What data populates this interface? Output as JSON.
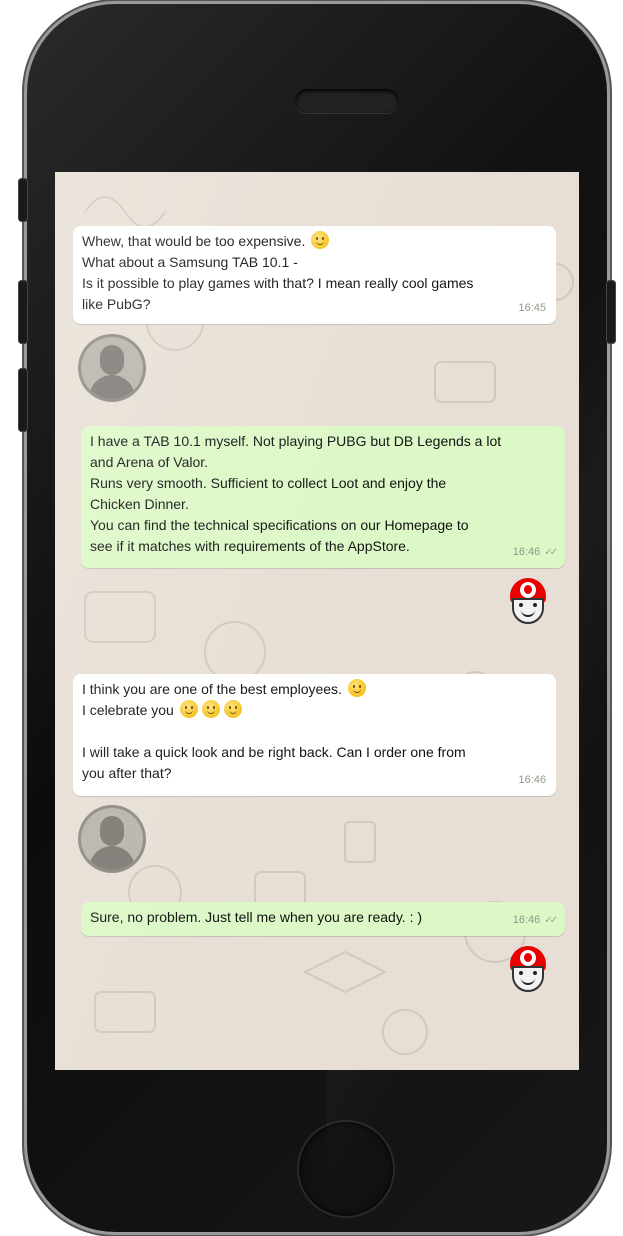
{
  "chat": {
    "messages": [
      {
        "direction": "incoming",
        "lines": [
          "Whew, that would be too expensive.",
          "What about a Samsung TAB 10.1 -",
          "Is it possible to play games with that? I mean really cool games",
          "like PubG?"
        ],
        "time": "16:45"
      },
      {
        "direction": "outgoing",
        "lines": [
          "I have a TAB 10.1 myself. Not playing PUBG but DB Legends a lot",
          "and Arena of Valor.",
          "Runs very smooth. Sufficient to collect Loot and enjoy the",
          "Chicken Dinner.",
          "You can find the technical specifications on our Homepage to",
          "see if it matches with requirements of the AppStore."
        ],
        "time": "16:46"
      },
      {
        "direction": "incoming",
        "lines": [
          "I think you are one of the best employees.",
          "I celebrate you",
          "",
          "I will take a quick look and be right back. Can I order one from",
          "you after that?"
        ],
        "time": "16:46"
      },
      {
        "direction": "outgoing",
        "lines": [
          "Sure, no problem. Just tell me when you are ready. : )"
        ],
        "time": "16:46"
      }
    ],
    "read_receipt": "✓✓",
    "emoji": "smiling-face-emoji"
  },
  "colors": {
    "incoming_bubble": "#ffffff",
    "outgoing_bubble": "#dcf8c6",
    "chat_background": "#e7dfd5",
    "bot_avatar_red": "#e60000"
  }
}
